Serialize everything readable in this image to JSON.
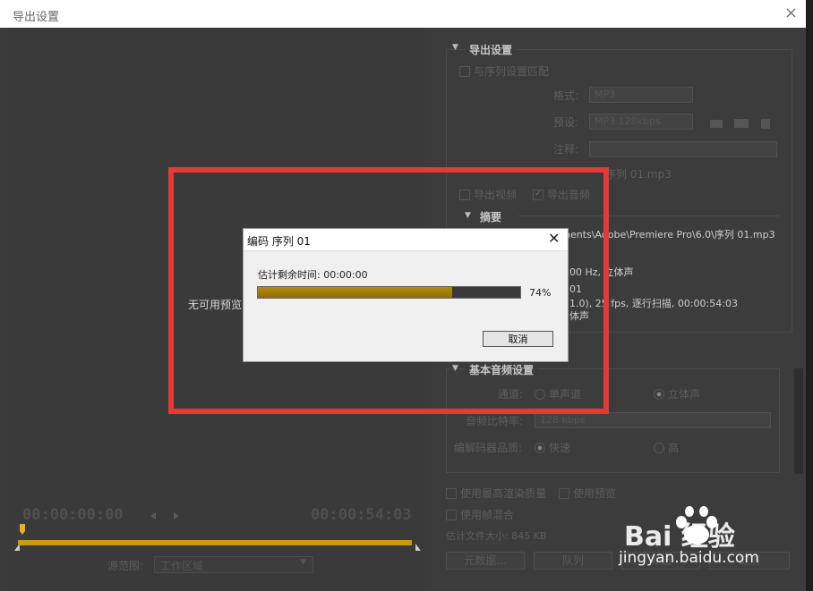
{
  "window": {
    "title": "导出设置",
    "close_glyph": "×"
  },
  "preview": {
    "no_preview": "无可用预览",
    "tc_start": "00:00:00:00",
    "tc_end": "00:00:54:03",
    "source_range_label": "源范围:",
    "source_range_value": "工作区域"
  },
  "export": {
    "header": "导出设置",
    "match_sequence": "与序列设置匹配",
    "format_label": "格式:",
    "format_value": "MP3",
    "preset_label": "预设:",
    "preset_value": "MP3 128kbps",
    "comments_label": "注释:",
    "output_name_value": "序列 01.mp3",
    "export_video": "导出视频",
    "export_audio": "导出音频",
    "export_audio_checked": true
  },
  "summary": {
    "header": "摘要",
    "line1": "nents\\Adobe\\Premiere Pro\\6.0\\序列 01.mp3",
    "line2": "00 Hz, 立体声",
    "line3": "01",
    "line4": "1.0), 25 fps, 逐行扫描, 00:00:54:03",
    "line5": "体声"
  },
  "audio": {
    "header": "基本音频设置",
    "channel_label": "通道:",
    "mono": "单声道",
    "stereo": "立体声",
    "bitrate_label": "音频比特率:",
    "bitrate_value": "128 kbps",
    "quality_label": "编解码器品质:",
    "fast": "快速",
    "high": "高"
  },
  "bottom": {
    "max_render": "使用最高渲染质量",
    "use_previews": "使用预览",
    "frame_blend": "使用帧混合",
    "est_size": "估计文件大小: 845 KB",
    "metadata_btn": "元数据...",
    "queue_btn": "队列",
    "export_btn": "导出",
    "cancel_btn": "取消"
  },
  "dialog": {
    "title": "编码 序列 01",
    "close_glyph": "✕",
    "eta": "估计剩余时间: 00:00:00",
    "progress_percent": 74,
    "progress_label": "74%",
    "cancel": "取消"
  },
  "watermark": {
    "brand": "Bai  经验",
    "url": "jingyan.baidu.com"
  },
  "colors": {
    "progress": "#b38c0f",
    "timeline": "#c99a12",
    "highlight": "#e53935"
  }
}
